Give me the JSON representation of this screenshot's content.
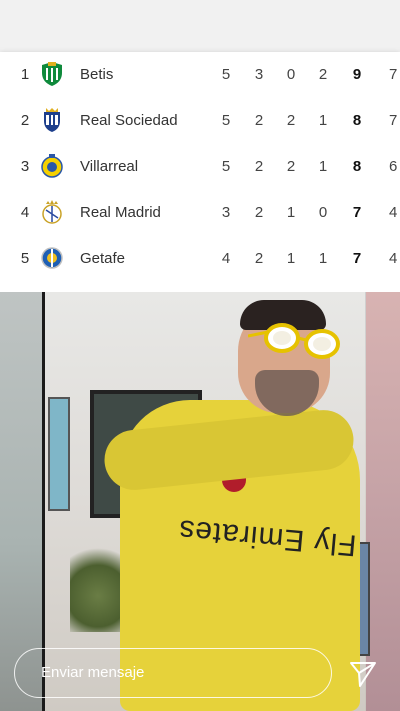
{
  "standings": [
    {
      "pos": "1",
      "team": "Betis",
      "gp": "5",
      "w": "3",
      "d": "0",
      "l": "2",
      "pts": "9",
      "extra": "7",
      "crest": "betis-crest-icon"
    },
    {
      "pos": "2",
      "team": "Real Sociedad",
      "gp": "5",
      "w": "2",
      "d": "2",
      "l": "1",
      "pts": "8",
      "extra": "7",
      "crest": "real-sociedad-crest-icon"
    },
    {
      "pos": "3",
      "team": "Villarreal",
      "gp": "5",
      "w": "2",
      "d": "2",
      "l": "1",
      "pts": "8",
      "extra": "6",
      "crest": "villarreal-crest-icon"
    },
    {
      "pos": "4",
      "team": "Real Madrid",
      "gp": "3",
      "w": "2",
      "d": "1",
      "l": "0",
      "pts": "7",
      "extra": "4",
      "crest": "real-madrid-crest-icon"
    },
    {
      "pos": "5",
      "team": "Getafe",
      "gp": "4",
      "w": "2",
      "d": "1",
      "l": "1",
      "pts": "7",
      "extra": "4",
      "crest": "getafe-crest-icon"
    }
  ],
  "video": {
    "shirt_text": "Fly Emirates"
  },
  "message_bar": {
    "placeholder": "Enviar mensaje",
    "send_icon": "send-icon"
  }
}
